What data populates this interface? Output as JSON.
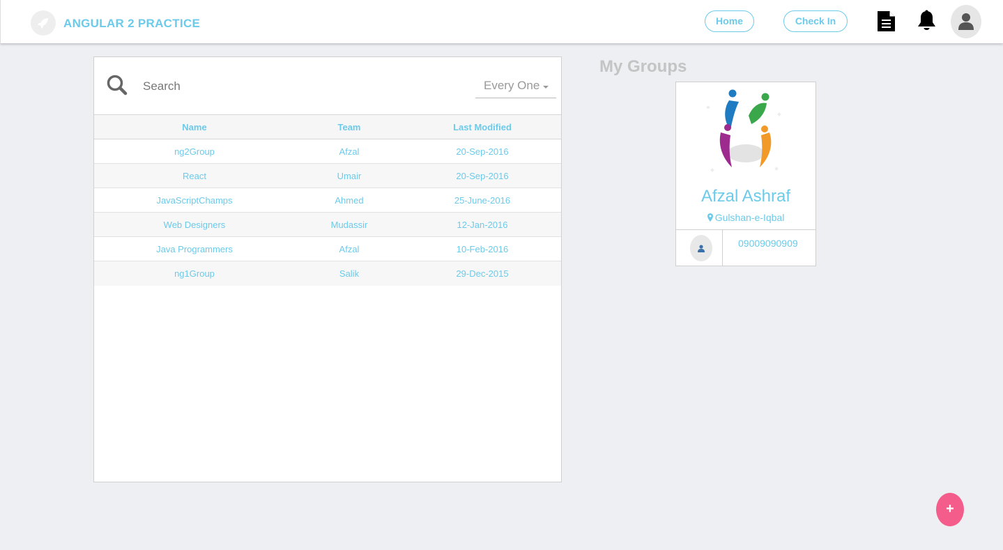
{
  "header": {
    "brand": "ANGULAR 2 PRACTICE",
    "nav": {
      "home": "Home",
      "check_in": "Check In"
    },
    "icons": [
      "rocket-icon",
      "document-icon",
      "bell-icon",
      "user-icon"
    ]
  },
  "search": {
    "placeholder": "Search",
    "value": "",
    "filter": "Every One"
  },
  "table": {
    "headers": [
      "Name",
      "Team",
      "Last Modified"
    ],
    "rows": [
      {
        "name": "ng2Group",
        "team": "Afzal",
        "modified": "20-Sep-2016"
      },
      {
        "name": "React",
        "team": "Umair",
        "modified": "20-Sep-2016"
      },
      {
        "name": "JavaScriptChamps",
        "team": "Ahmed",
        "modified": "25-June-2016"
      },
      {
        "name": "Web Designers",
        "team": "Mudassir",
        "modified": "12-Jan-2016"
      },
      {
        "name": "Java Programmers",
        "team": "Afzal",
        "modified": "10-Feb-2016"
      },
      {
        "name": "ng1Group",
        "team": "Salik",
        "modified": "29-Dec-2015"
      }
    ]
  },
  "my_groups": {
    "title": "My Groups",
    "profile": {
      "name": "Afzal Ashraf",
      "location": "Gulshan-e-Iqbal",
      "phone": "09009090909"
    }
  },
  "fab": {
    "label": "+"
  },
  "colors": {
    "accent": "#6ccaea",
    "fab": "#f45c8b",
    "background": "#eeeff3"
  }
}
